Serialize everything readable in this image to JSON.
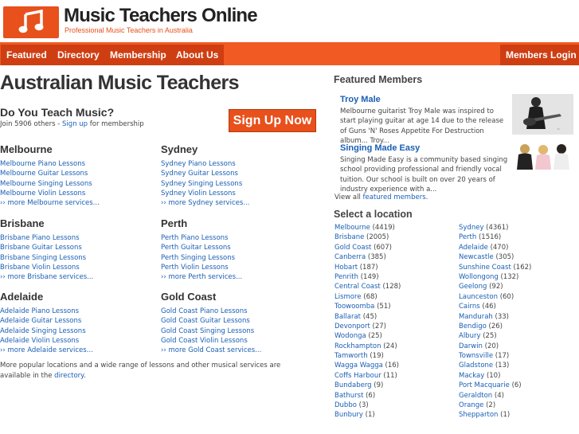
{
  "header": {
    "title": "Music Teachers Online",
    "tagline": "Professional Music Teachers in Australia"
  },
  "nav": {
    "items": [
      "Featured",
      "Directory",
      "Membership",
      "About Us"
    ],
    "login": "Members Login"
  },
  "main": {
    "heading": "Australian Music Teachers",
    "teach_heading": "Do You Teach Music?",
    "join_prefix": "Join 5906 others - ",
    "join_link": "Sign up",
    "join_suffix": " for membership",
    "signup_button": "Sign Up Now",
    "cities": [
      {
        "name": "Melbourne",
        "links": [
          "Melbourne Piano Lessons",
          "Melbourne Guitar Lessons",
          "Melbourne Singing Lessons",
          "Melbourne Violin Lessons"
        ],
        "more": "more Melbourne services..."
      },
      {
        "name": "Sydney",
        "links": [
          "Sydney Piano Lessons",
          "Sydney Guitar Lessons",
          "Sydney Singing Lessons",
          "Sydney Violin Lessons"
        ],
        "more": "more Sydney services..."
      },
      {
        "name": "Brisbane",
        "links": [
          "Brisbane Piano Lessons",
          "Brisbane Guitar Lessons",
          "Brisbane Singing Lessons",
          "Brisbane Violin Lessons"
        ],
        "more": "more Brisbane services..."
      },
      {
        "name": "Perth",
        "links": [
          "Perth Piano Lessons",
          "Perth Guitar Lessons",
          "Perth Singing Lessons",
          "Perth Violin Lessons"
        ],
        "more": "more Perth services..."
      },
      {
        "name": "Adelaide",
        "links": [
          "Adelaide Piano Lessons",
          "Adelaide Guitar Lessons",
          "Adelaide Singing Lessons",
          "Adelaide Violin Lessons"
        ],
        "more": "more Adelaide services..."
      },
      {
        "name": "Gold Coast",
        "links": [
          "Gold Coast Piano Lessons",
          "Gold Coast Guitar Lessons",
          "Gold Coast Singing Lessons",
          "Gold Coast Violin Lessons"
        ],
        "more": "more Gold Coast services..."
      }
    ],
    "more_arrow": "››",
    "footer_text": "More popular locations and a wide range of lessons and other musical services are available in the ",
    "footer_link": "directory",
    "footer_end": "."
  },
  "featured": {
    "heading": "Featured Members",
    "members": [
      {
        "name": "Troy Male",
        "desc": "Melbourne guitarist Troy Male was inspired to start playing guitar at age 14 due to the release of Guns 'N' Roses Appetite For Destruction album... Troy..."
      },
      {
        "name": "Singing Made Easy",
        "desc": "Singing Made Easy is a community based singing school providing professional and friendly vocal tuition. Our school is built on over 20 years of industry experience with a..."
      }
    ],
    "view_all_prefix": "View all ",
    "view_all_link": "featured members",
    "view_all_suffix": "."
  },
  "locations": {
    "heading": "Select a location",
    "left": [
      {
        "name": "Melbourne",
        "count": "(4419)"
      },
      {
        "name": "Brisbane",
        "count": "(2005)"
      },
      {
        "name": "Gold Coast",
        "count": "(607)"
      },
      {
        "name": "Canberra",
        "count": "(385)"
      },
      {
        "name": "Hobart",
        "count": "(187)"
      },
      {
        "name": "Penrith",
        "count": "(149)"
      },
      {
        "name": "Central Coast",
        "count": "(128)"
      },
      {
        "name": "Lismore",
        "count": "(68)"
      },
      {
        "name": "Toowoomba",
        "count": "(51)"
      },
      {
        "name": "Ballarat",
        "count": "(45)"
      },
      {
        "name": "Devonport",
        "count": "(27)"
      },
      {
        "name": "Wodonga",
        "count": "(25)"
      },
      {
        "name": "Rockhampton",
        "count": "(24)"
      },
      {
        "name": "Tamworth",
        "count": "(19)"
      },
      {
        "name": "Wagga Wagga",
        "count": "(16)"
      },
      {
        "name": "Coffs Harbour",
        "count": "(11)"
      },
      {
        "name": "Bundaberg",
        "count": "(9)"
      },
      {
        "name": "Bathurst",
        "count": "(6)"
      },
      {
        "name": "Dubbo",
        "count": "(3)"
      },
      {
        "name": "Bunbury",
        "count": "(1)"
      }
    ],
    "right": [
      {
        "name": "Sydney",
        "count": "(4361)"
      },
      {
        "name": "Perth",
        "count": "(1516)"
      },
      {
        "name": "Adelaide",
        "count": "(470)"
      },
      {
        "name": "Newcastle",
        "count": "(305)"
      },
      {
        "name": "Sunshine Coast",
        "count": "(162)"
      },
      {
        "name": "Wollongong",
        "count": "(132)"
      },
      {
        "name": "Geelong",
        "count": "(92)"
      },
      {
        "name": "Launceston",
        "count": "(60)"
      },
      {
        "name": "Cairns",
        "count": "(46)"
      },
      {
        "name": "Mandurah",
        "count": "(33)"
      },
      {
        "name": "Bendigo",
        "count": "(26)"
      },
      {
        "name": "Albury",
        "count": "(25)"
      },
      {
        "name": "Darwin",
        "count": "(20)"
      },
      {
        "name": "Townsville",
        "count": "(17)"
      },
      {
        "name": "Gladstone",
        "count": "(13)"
      },
      {
        "name": "Mackay",
        "count": "(10)"
      },
      {
        "name": "Port Macquarie",
        "count": "(6)"
      },
      {
        "name": "Geraldton",
        "count": "(4)"
      },
      {
        "name": "Orange",
        "count": "(2)"
      },
      {
        "name": "Shepparton",
        "count": "(1)"
      }
    ]
  },
  "colors": {
    "accent": "#f15a22",
    "nav_tab": "#cf3e12",
    "link": "#1a5fb4"
  }
}
